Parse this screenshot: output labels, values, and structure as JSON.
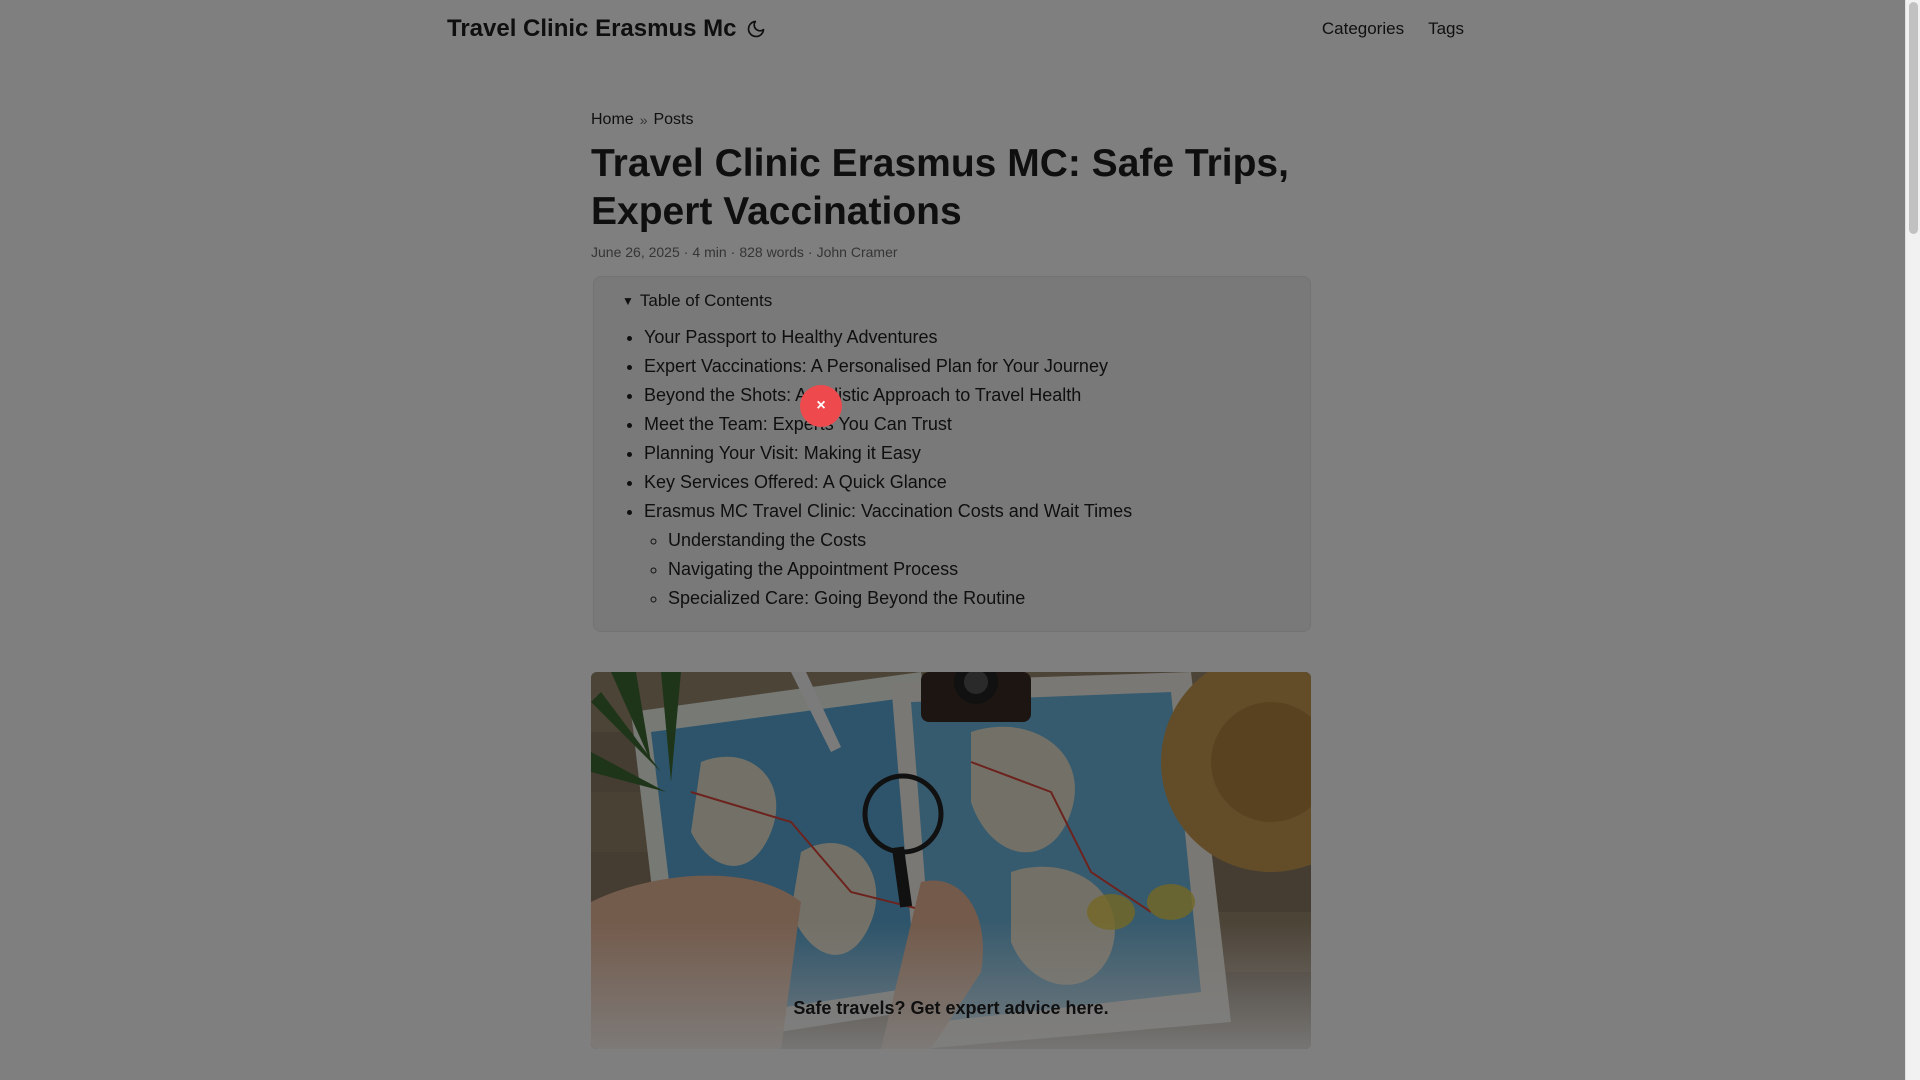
{
  "header": {
    "site_title": "Travel Clinic Erasmus Mc",
    "theme_toggle_icon": "moon-icon",
    "nav": [
      "Categories",
      "Tags"
    ]
  },
  "breadcrumb": {
    "home": "Home",
    "separator": "»",
    "posts": "Posts"
  },
  "article": {
    "title": "Travel Clinic Erasmus MC: Safe Trips, Expert Vaccinations",
    "date": "June 26, 2025",
    "read_time": "4 min",
    "words": "828 words",
    "author": "John Cramer",
    "meta_separator": "·"
  },
  "toc": {
    "summary": "Table of Contents",
    "items": [
      "Your Passport to Healthy Adventures",
      "Expert Vaccinations: A Personalised Plan for Your Journey",
      "Beyond the Shots: A Holistic Approach to Travel Health",
      "Meet the Team: Experts You Can Trust",
      "Planning Your Visit: Making it Easy",
      "Key Services Offered: A Quick Glance",
      "Erasmus MC Travel Clinic: Vaccination Costs and Wait Times"
    ],
    "subitems": [
      "Understanding the Costs",
      "Navigating the Appointment Process",
      "Specialized Care: Going Beyond the Routine"
    ]
  },
  "hero": {
    "caption": "Safe travels?  Get expert advice here."
  },
  "overlay": {
    "close_label": "×"
  },
  "colors": {
    "overlay": "#000000",
    "close_button": "#ee4a4e",
    "map_water": "#5aa9d6",
    "table_wood": "#8b7a64"
  }
}
